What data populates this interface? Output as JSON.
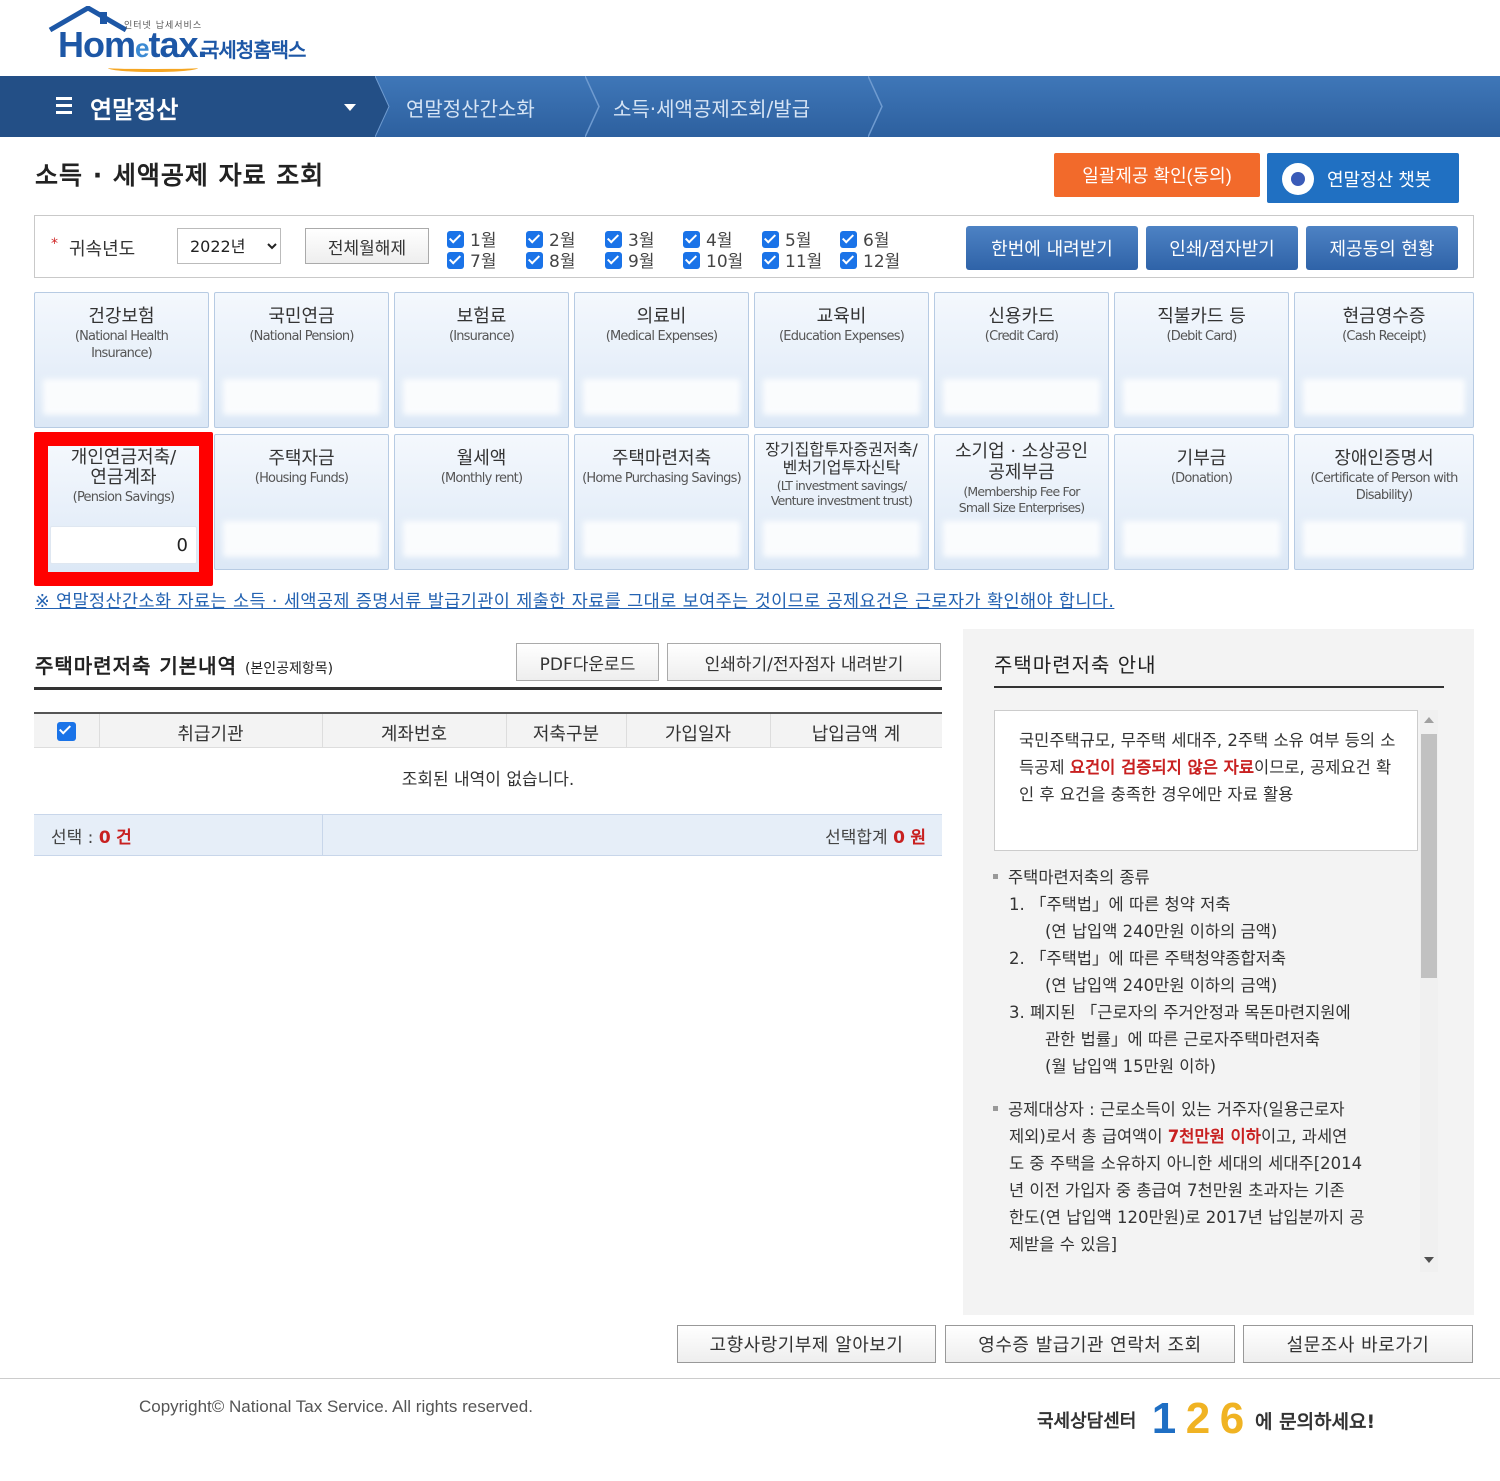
{
  "logo": {
    "mini_text": "인터넷 납세서비스",
    "home": "Hom",
    "e": "e",
    "tax": "tax.",
    "korean": "국세청홈택스"
  },
  "nav": {
    "main_menu": "연말정산",
    "breadcrumbs": [
      "연말정산간소화",
      "소득·세액공제조회/발급"
    ]
  },
  "page": {
    "title": "소득 · 세액공제 자료 조회",
    "consent_button": "일괄제공 확인(동의)",
    "chatbot_button": "연말정산 챗봇"
  },
  "filter": {
    "year_label": "귀속년도",
    "year_value": "2022년",
    "clear_button": "전체월해제",
    "months": [
      "1월",
      "2월",
      "3월",
      "4월",
      "5월",
      "6월",
      "7월",
      "8월",
      "9월",
      "10월",
      "11월",
      "12월"
    ],
    "download_all": "한번에 내려받기",
    "print": "인쇄/점자받기",
    "consent_status": "제공동의 현황"
  },
  "categories": [
    {
      "kr": "건강보험",
      "en": "(National Health Insurance)"
    },
    {
      "kr": "국민연금",
      "en": "(National Pension)"
    },
    {
      "kr": "보험료",
      "en": "(Insurance)"
    },
    {
      "kr": "의료비",
      "en": "(Medical Expenses)"
    },
    {
      "kr": "교육비",
      "en": "(Education Expenses)"
    },
    {
      "kr": "신용카드",
      "en": "(Credit Card)"
    },
    {
      "kr": "직불카드 등",
      "en": "(Debit Card)"
    },
    {
      "kr": "현금영수증",
      "en": "(Cash Receipt)"
    },
    {
      "kr": "개인연금저축/ 연금계좌",
      "en": "(Pension Savings)",
      "value": "0"
    },
    {
      "kr": "주택자금",
      "en": "(Housing Funds)"
    },
    {
      "kr": "월세액",
      "en": "(Monthly rent)"
    },
    {
      "kr": "주택마련저축",
      "en": "(Home Purchasing Savings)"
    },
    {
      "kr": "장기집합투자증권저축/ 벤처기업투자신탁",
      "en": "(LT investment savings/ Venture investment trust)"
    },
    {
      "kr": "소기업 · 소상공인 공제부금",
      "en": "(Membership Fee For Small Size Enterprises)"
    },
    {
      "kr": "기부금",
      "en": "(Donation)"
    },
    {
      "kr": "장애인증명서",
      "en": "(Certificate of Person with Disability)"
    }
  ],
  "notice": "※ 연말정산간소화 자료는 소득 · 세액공제 증명서류 발급기관이 제출한 자료를 그대로 보여주는 것이므로 공제요건은 근로자가 확인해야 합니다.",
  "section": {
    "title": "주택마련저축 기본내역",
    "subtitle": "(본인공제항목)",
    "pdf_button": "PDF다운로드",
    "print_button": "인쇄하기/전자점자 내려받기",
    "columns": [
      "취급기관",
      "계좌번호",
      "저축구분",
      "가입일자",
      "납입금액 계"
    ],
    "empty_message": "조회된 내역이 없습니다.",
    "selected_label": "선택 :",
    "selected_count": "0",
    "selected_unit": "건",
    "total_label": "선택합계",
    "total_value": "0",
    "total_unit": "원"
  },
  "guide": {
    "title": "주택마련저축 안내",
    "box_text_1": "국민주택규모, 무주택 세대주, 2주택 소유 여부 등의 소득공제 ",
    "box_text_red": "요건이 검증되지 않은 자료",
    "box_text_2": "이므로, 공제요건 확인 후 요건을 충족한 경우에만 자료 활용",
    "types_heading": "주택마련저축의 종류",
    "type_1": "1. 「주택법」에 따른 청약 저축",
    "type_1_note": "(연 납입액 240만원 이하의 금액)",
    "type_2": "2. 「주택법」에 따른 주택청약종합저축",
    "type_2_note": "(연 납입액 240만원 이하의 금액)",
    "type_3": "3. 폐지된 「근로자의 주거안정과 목돈마련지원에",
    "type_3_cont": "관한 법률」에 따른 근로자주택마련저축",
    "type_3_note": "(월 납입액 15만원 이하)",
    "target_1": "공제대상자 : 근로소득이 있는 거주자(일용근로자",
    "target_2": "제외)로서 총 급여액이 ",
    "target_red": "7천만원 이하",
    "target_3": "이고, 과세연",
    "target_4": "도 중 주택을 소유하지 아니한 세대의 세대주[2014",
    "target_5": "년 이전 가입자 중 총급여 7천만원 초과자는 기존",
    "target_6": "한도(연 납입액 120만원)로 2017년 납입분까지 공",
    "target_7": "제받을 수 있음]"
  },
  "bottom_buttons": [
    "고향사랑기부제 알아보기",
    "영수증 발급기관 연락처 조회",
    "설문조사 바로가기"
  ],
  "footer": {
    "copyright": "Copyright© National Tax Service. All rights reserved.",
    "center_text": "국세상담센터",
    "number": [
      "1",
      "2",
      "6"
    ],
    "ask_text": "에 문의하세요!"
  },
  "colors": {
    "nav_blue": "#2d609f",
    "nav_dark": "#234f86",
    "accent_orange": "#f26a2b",
    "highlight_red": "#ff0000",
    "link_blue": "#2463b2"
  }
}
